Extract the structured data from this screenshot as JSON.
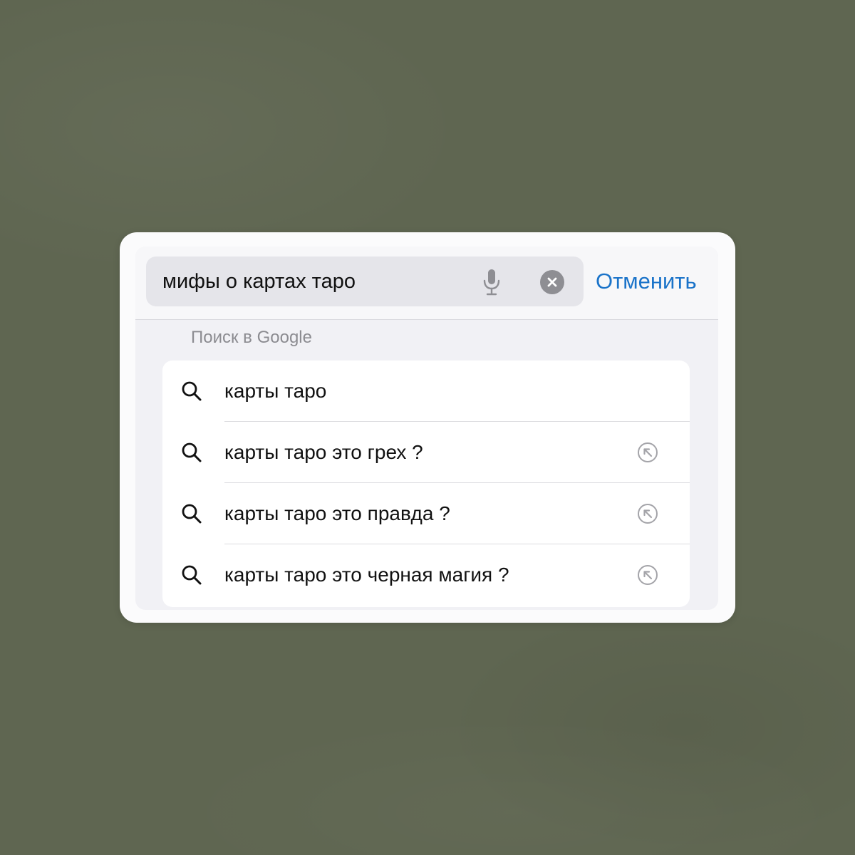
{
  "search": {
    "query": "мифы о картах таро",
    "cancel_label": "Отменить"
  },
  "suggestions": {
    "section_title": "Поиск в Google",
    "items": [
      {
        "label": "карты таро",
        "has_fill_arrow": false
      },
      {
        "label": "карты таро это грех ?",
        "has_fill_arrow": true
      },
      {
        "label": "карты таро это правда ?",
        "has_fill_arrow": true
      },
      {
        "label": "карты таро это черная магия ?",
        "has_fill_arrow": true
      }
    ]
  },
  "colors": {
    "background": "#5f6651",
    "accent": "#1a73c9",
    "field_fill": "#e5e5ea",
    "secondary_text": "#8c8c91"
  },
  "icons": {
    "microphone": "microphone-icon",
    "clear": "clear-circle-icon",
    "search": "magnifier-icon",
    "fill": "arrow-up-left-circle-icon"
  }
}
